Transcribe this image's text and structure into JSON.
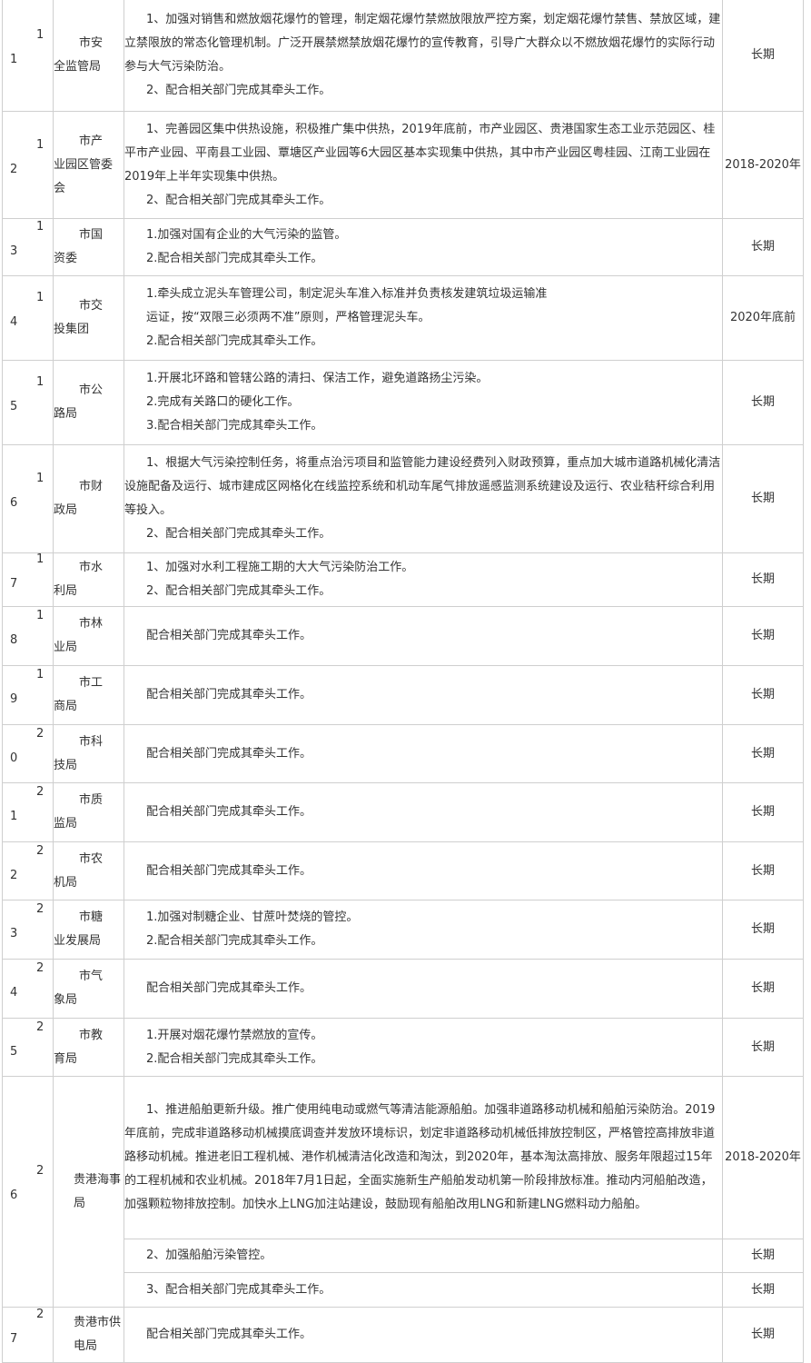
{
  "rows": [
    {
      "num": "11",
      "dept_l1": "市安",
      "dept_l2": "全监管局",
      "tasks": [
        {
          "text": "1、加强对销售和燃放烟花爆竹的管理，制定烟花爆竹禁燃放限放严控方案，划定烟花爆竹禁售、禁放区域，建立禁限放的常态化管理机制。广泛开展禁燃禁放烟花爆竹的宣传教育，引导广大群众以不燃放烟花爆竹的实际行动参与大气污染防治。",
          "style": "para"
        },
        {
          "text": "2、配合相关部门完成其牵头工作。",
          "style": "para"
        }
      ],
      "term": "长期"
    },
    {
      "num": "12",
      "dept_l1": "市产",
      "dept_l2": "业园区管委会",
      "tasks": [
        {
          "text": "1、完善园区集中供热设施，积极推广集中供热，2019年底前，市产业园区、贵港国家生态工业示范园区、桂平市产业园、平南县工业园、覃塘区产业园等6大园区基本实现集中供热，其中市产业园区粤桂园、江南工业园在2019年上半年实现集中供热。",
          "style": "para"
        },
        {
          "text": "2、配合相关部门完成其牵头工作。",
          "style": "para"
        }
      ],
      "term": "2018-2020年"
    },
    {
      "num": "13",
      "dept_l1": "市国",
      "dept_l2": "资委",
      "tasks": [
        {
          "text": "1.加强对国有企业的大气污染的监管。",
          "style": "plain"
        },
        {
          "text": "2.配合相关部门完成其牵头工作。",
          "style": "plain"
        }
      ],
      "term": "长期"
    },
    {
      "num": "14",
      "dept_l1": "市交",
      "dept_l2": "投集团",
      "tasks": [
        {
          "text": "1.牵头成立泥头车管理公司，制定泥头车准入标准并负责核发建筑垃圾运输准",
          "style": "plain"
        },
        {
          "text": "运证，按“双限三必须两不准”原则，严格管理泥头车。",
          "style": "plain"
        },
        {
          "text": "2.配合相关部门完成其牵头工作。",
          "style": "plain"
        }
      ],
      "term": "2020年底前"
    },
    {
      "num": "15",
      "dept_l1": "市公",
      "dept_l2": "路局",
      "tasks": [
        {
          "text": "1.开展北环路和管辖公路的清扫、保洁工作，避免道路扬尘污染。",
          "style": "plain"
        },
        {
          "text": "2.完成有关路口的硬化工作。",
          "style": "plain"
        },
        {
          "text": "3.配合相关部门完成其牵头工作。",
          "style": "plain"
        }
      ],
      "term": "长期"
    },
    {
      "num": "16",
      "dept_l1": "市财",
      "dept_l2": "政局",
      "tasks": [
        {
          "text": "1、根据大气污染控制任务，将重点治污项目和监管能力建设经费列入财政预算，重点加大城市道路机械化清洁设施配备及运行、城市建成区网格化在线监控系统和机动车尾气排放遥感监测系统建设及运行、农业秸秆综合利用等投入。",
          "style": "para"
        },
        {
          "text": "2、配合相关部门完成其牵头工作。",
          "style": "para"
        }
      ],
      "term": "长期"
    },
    {
      "num": "17",
      "dept_l1": "市水",
      "dept_l2": "利局",
      "tasks": [
        {
          "text": "1、加强对水利工程施工期的大大气污染防治工作。",
          "style": "plain"
        },
        {
          "text": "2、配合相关部门完成其牵头工作。",
          "style": "plain"
        }
      ],
      "term": "长期"
    },
    {
      "num": "18",
      "dept_l1": "市林",
      "dept_l2": "业局",
      "tasks": [
        {
          "text": "配合相关部门完成其牵头工作。",
          "style": "plain"
        }
      ],
      "term": "长期"
    },
    {
      "num": "19",
      "dept_l1": "市工",
      "dept_l2": "商局",
      "tasks": [
        {
          "text": "配合相关部门完成其牵头工作。",
          "style": "plain"
        }
      ],
      "term": "长期"
    },
    {
      "num": "20",
      "dept_l1": "市科",
      "dept_l2": "技局",
      "tasks": [
        {
          "text": "配合相关部门完成其牵头工作。",
          "style": "plain"
        }
      ],
      "term": "长期"
    },
    {
      "num": "21",
      "dept_l1": "市质",
      "dept_l2": "监局",
      "tasks": [
        {
          "text": "配合相关部门完成其牵头工作。",
          "style": "plain"
        }
      ],
      "term": "长期"
    },
    {
      "num": "22",
      "dept_l1": "市农",
      "dept_l2": "机局",
      "tasks": [
        {
          "text": "配合相关部门完成其牵头工作。",
          "style": "plain"
        }
      ],
      "term": "长期"
    },
    {
      "num": "23",
      "dept_l1": "市糖",
      "dept_l2": "业发展局",
      "tasks": [
        {
          "text": "1.加强对制糖企业、甘蔗叶焚烧的管控。",
          "style": "plain"
        },
        {
          "text": "2.配合相关部门完成其牵头工作。",
          "style": "plain"
        }
      ],
      "term": "长期"
    },
    {
      "num": "24",
      "dept_l1": "市气",
      "dept_l2": "象局",
      "tasks": [
        {
          "text": "配合相关部门完成其牵头工作。",
          "style": "plain"
        }
      ],
      "term": "长期"
    },
    {
      "num": "25",
      "dept_l1": "市教",
      "dept_l2": "育局",
      "tasks": [
        {
          "text": "1.开展对烟花爆竹禁燃放的宣传。",
          "style": "plain"
        },
        {
          "text": "2.配合相关部门完成其牵头工作。",
          "style": "plain"
        }
      ],
      "term": "长期"
    }
  ],
  "row26": {
    "num": "26",
    "dept": "贵港海事局",
    "sub": [
      {
        "text": "1、推进船舶更新升级。推广使用纯电动或燃气等清洁能源船舶。加强非道路移动机械和船舶污染防治。2019年底前，完成非道路移动机械摸底调查并发放环境标识，划定非道路移动机械低排放控制区，严格管控高排放非道路移动机械。推进老旧工程机械、港作机械清洁化改造和淘汰，到2020年，基本淘汰高排放、服务年限超过15年的工程机械和农业机械。2018年7月1日起，全面实施新生产船舶发动机第一阶段排放标准。推动内河船舶改造，加强颗粒物排放控制。加快水上LNG加注站建设，鼓励现有船舶改用LNG和新建LNG燃料动力船舶。",
        "term": "2018-2020年"
      },
      {
        "text": "2、加强船舶污染管控。",
        "term": "长期"
      },
      {
        "text": "3、配合相关部门完成其牵头工作。",
        "term": "长期"
      }
    ]
  },
  "row27": {
    "num": "27",
    "dept": "贵港市供电局",
    "task": "配合相关部门完成其牵头工作。",
    "term": "长期"
  }
}
